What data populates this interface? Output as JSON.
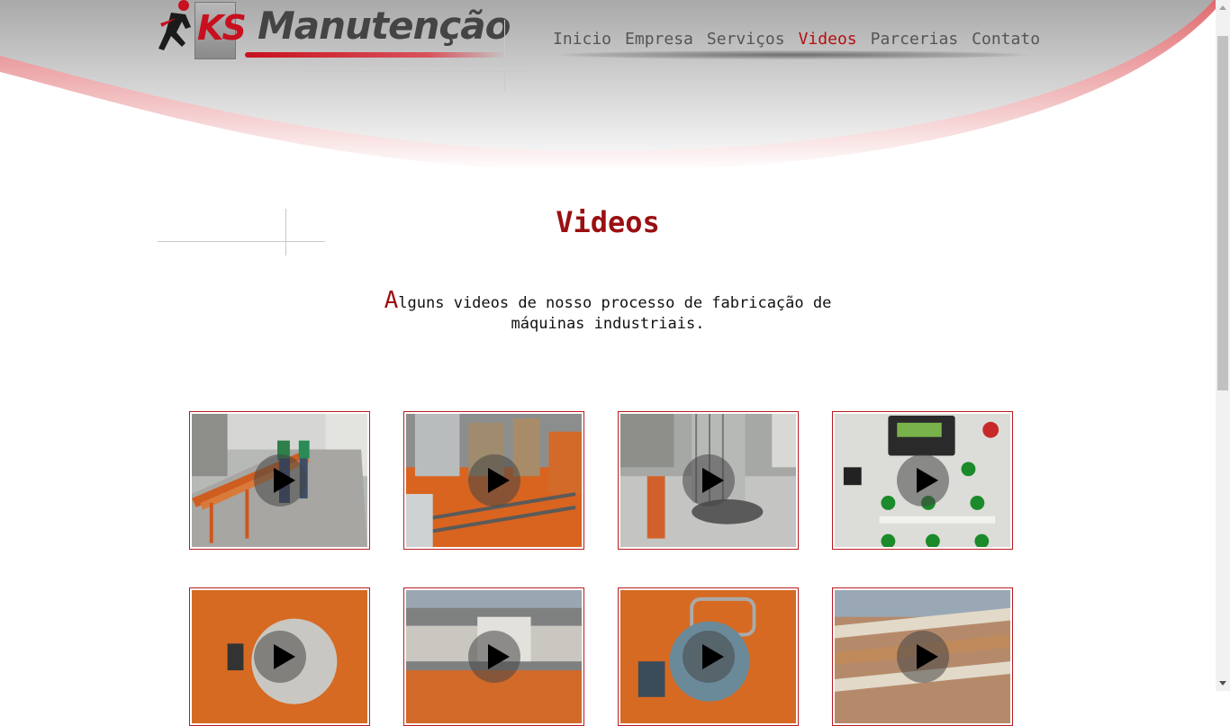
{
  "logo": {
    "mark": "KS",
    "name": "Manutenção"
  },
  "nav": {
    "items": [
      {
        "label": "Inicio"
      },
      {
        "label": "Empresa"
      },
      {
        "label": "Serviços"
      },
      {
        "label": "Videos",
        "active": true
      },
      {
        "label": "Parcerias"
      },
      {
        "label": "Contato"
      }
    ]
  },
  "main": {
    "title": "Videos",
    "intro_first_letter": "A",
    "intro_rest": "lguns videos de nosso processo de fabricação de máquinas industriais."
  },
  "videos": [
    {
      "scene": "workers in factory hall with orange frame",
      "icon": "play-icon"
    },
    {
      "scene": "orange machine with wire rods",
      "icon": "play-icon"
    },
    {
      "scene": "wire coil machine in empty hall",
      "icon": "play-icon"
    },
    {
      "scene": "control panel with green buttons",
      "icon": "play-icon"
    },
    {
      "scene": "orange machine with round plate",
      "icon": "play-icon"
    },
    {
      "scene": "welding machine with cables",
      "icon": "play-icon"
    },
    {
      "scene": "orange bending head",
      "icon": "play-icon"
    },
    {
      "scene": "conveyor with wooden slats",
      "icon": "play-icon"
    }
  ],
  "colors": {
    "accent": "#9a0f11",
    "nav_active": "#b30f12",
    "nav_text": "#555555",
    "thumb_border": "#b81d22"
  }
}
